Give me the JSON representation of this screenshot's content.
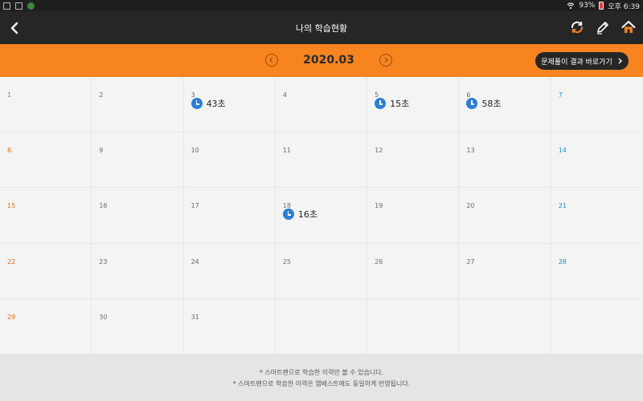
{
  "status_bar": {
    "battery": "93%",
    "time": "오후 6:39"
  },
  "header": {
    "title": "나의 학습현황"
  },
  "month_bar": {
    "month": "2020.03",
    "goto_label": "문제풀이 결과 바로가기"
  },
  "calendar": {
    "days": [
      {
        "day": "1",
        "type": "sun",
        "time": ""
      },
      {
        "day": "2",
        "type": "wk",
        "time": ""
      },
      {
        "day": "3",
        "type": "wk",
        "time": "43초"
      },
      {
        "day": "4",
        "type": "wk",
        "time": ""
      },
      {
        "day": "5",
        "type": "wk",
        "time": "15초"
      },
      {
        "day": "6",
        "type": "wk",
        "time": "58초"
      },
      {
        "day": "7",
        "type": "sat",
        "time": ""
      },
      {
        "day": "8",
        "type": "sun",
        "time": ""
      },
      {
        "day": "9",
        "type": "wk",
        "time": ""
      },
      {
        "day": "10",
        "type": "wk",
        "time": ""
      },
      {
        "day": "11",
        "type": "wk",
        "time": ""
      },
      {
        "day": "12",
        "type": "wk",
        "time": ""
      },
      {
        "day": "13",
        "type": "wk",
        "time": ""
      },
      {
        "day": "14",
        "type": "sat",
        "time": ""
      },
      {
        "day": "15",
        "type": "sun",
        "time": ""
      },
      {
        "day": "16",
        "type": "wk",
        "time": ""
      },
      {
        "day": "17",
        "type": "wk",
        "time": ""
      },
      {
        "day": "18",
        "type": "wk",
        "time": "16초"
      },
      {
        "day": "19",
        "type": "wk",
        "time": ""
      },
      {
        "day": "20",
        "type": "wk",
        "time": ""
      },
      {
        "day": "21",
        "type": "sat",
        "time": ""
      },
      {
        "day": "22",
        "type": "sun",
        "time": ""
      },
      {
        "day": "23",
        "type": "wk",
        "time": ""
      },
      {
        "day": "24",
        "type": "wk",
        "time": ""
      },
      {
        "day": "25",
        "type": "wk",
        "time": ""
      },
      {
        "day": "26",
        "type": "wk",
        "time": ""
      },
      {
        "day": "27",
        "type": "wk",
        "time": ""
      },
      {
        "day": "28",
        "type": "sat",
        "time": ""
      },
      {
        "day": "29",
        "type": "sun",
        "time": ""
      },
      {
        "day": "30",
        "type": "wk",
        "time": ""
      },
      {
        "day": "31",
        "type": "wk",
        "time": ""
      },
      {
        "day": "",
        "type": "empty",
        "time": ""
      },
      {
        "day": "",
        "type": "empty",
        "time": ""
      },
      {
        "day": "",
        "type": "empty",
        "time": ""
      },
      {
        "day": "",
        "type": "empty",
        "time": ""
      }
    ]
  },
  "footer": {
    "note1": "* 스마트펜으로 학습한 이력만 볼 수 있습니다.",
    "note2": "* 스마트펜으로 학습한 이력은 엠베스트에도 동일하게 반영됩니다."
  },
  "colors": {
    "accent": "#f7841f",
    "sunday": "#e66a18",
    "saturday": "#1e8ec9",
    "clock": "#2a7fd6"
  }
}
